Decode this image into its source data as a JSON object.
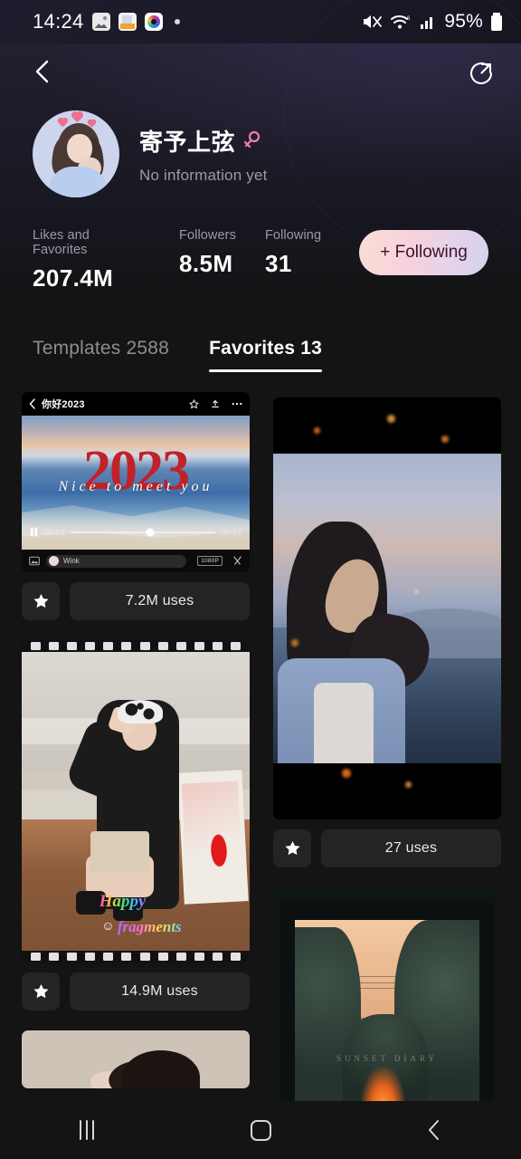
{
  "status_bar": {
    "time": "14:24",
    "battery_percent": "95%",
    "icons": [
      "photos-icon",
      "file-icon",
      "camera-icon",
      "dot-indicator"
    ],
    "right_icons": [
      "mute-icon",
      "wifi-icon",
      "signal-icon",
      "battery-icon"
    ]
  },
  "header": {
    "back_icon": "chevron-left-icon",
    "share_icon": "share-circle-icon"
  },
  "profile": {
    "username": "寄予上弦",
    "gender_icon": "female-gender-icon",
    "bio": "No information yet",
    "avatar_alt": "user-avatar",
    "stats": [
      {
        "label": "Likes and Favorites",
        "value": "207.4M"
      },
      {
        "label": "Followers",
        "value": "8.5M"
      },
      {
        "label": "Following",
        "value": "31"
      }
    ],
    "follow_button": {
      "label": "+ Following",
      "gradient_from": "#fbdcd4",
      "gradient_to": "#d6d1ee",
      "text_color": "#3e1428"
    }
  },
  "tabs": [
    {
      "label": "Templates 2588",
      "active": false
    },
    {
      "label": "Favorites 13",
      "active": true
    }
  ],
  "grid": {
    "left_column": [
      {
        "type": "video-player-thumb",
        "video_title": "你好2023",
        "overlay_year": "2023",
        "overlay_subtitle": "Nice to meet you",
        "current_time": "00:52",
        "total_time": "03:28",
        "watermark": "Wink",
        "quality_badge": "1080P",
        "uses": "7.2M uses",
        "star_icon": "star-filled-icon"
      },
      {
        "type": "film-strip-photo",
        "overlay_text_1": "Happy",
        "overlay_text_2": "fragments",
        "smiley": "☺",
        "uses": "14.9M uses",
        "star_icon": "star-filled-icon"
      },
      {
        "type": "partial-photo"
      }
    ],
    "right_column": [
      {
        "type": "portrait-photo",
        "uses": "27 uses",
        "star_icon": "star-filled-icon"
      },
      {
        "type": "sunset-trees-photo",
        "caption": "SUNSET DIARY"
      }
    ]
  },
  "bottom_nav": [
    {
      "name": "recents-button",
      "icon": "recents-icon"
    },
    {
      "name": "home-button",
      "icon": "home-icon"
    },
    {
      "name": "back-button",
      "icon": "chevron-left-icon"
    }
  ]
}
